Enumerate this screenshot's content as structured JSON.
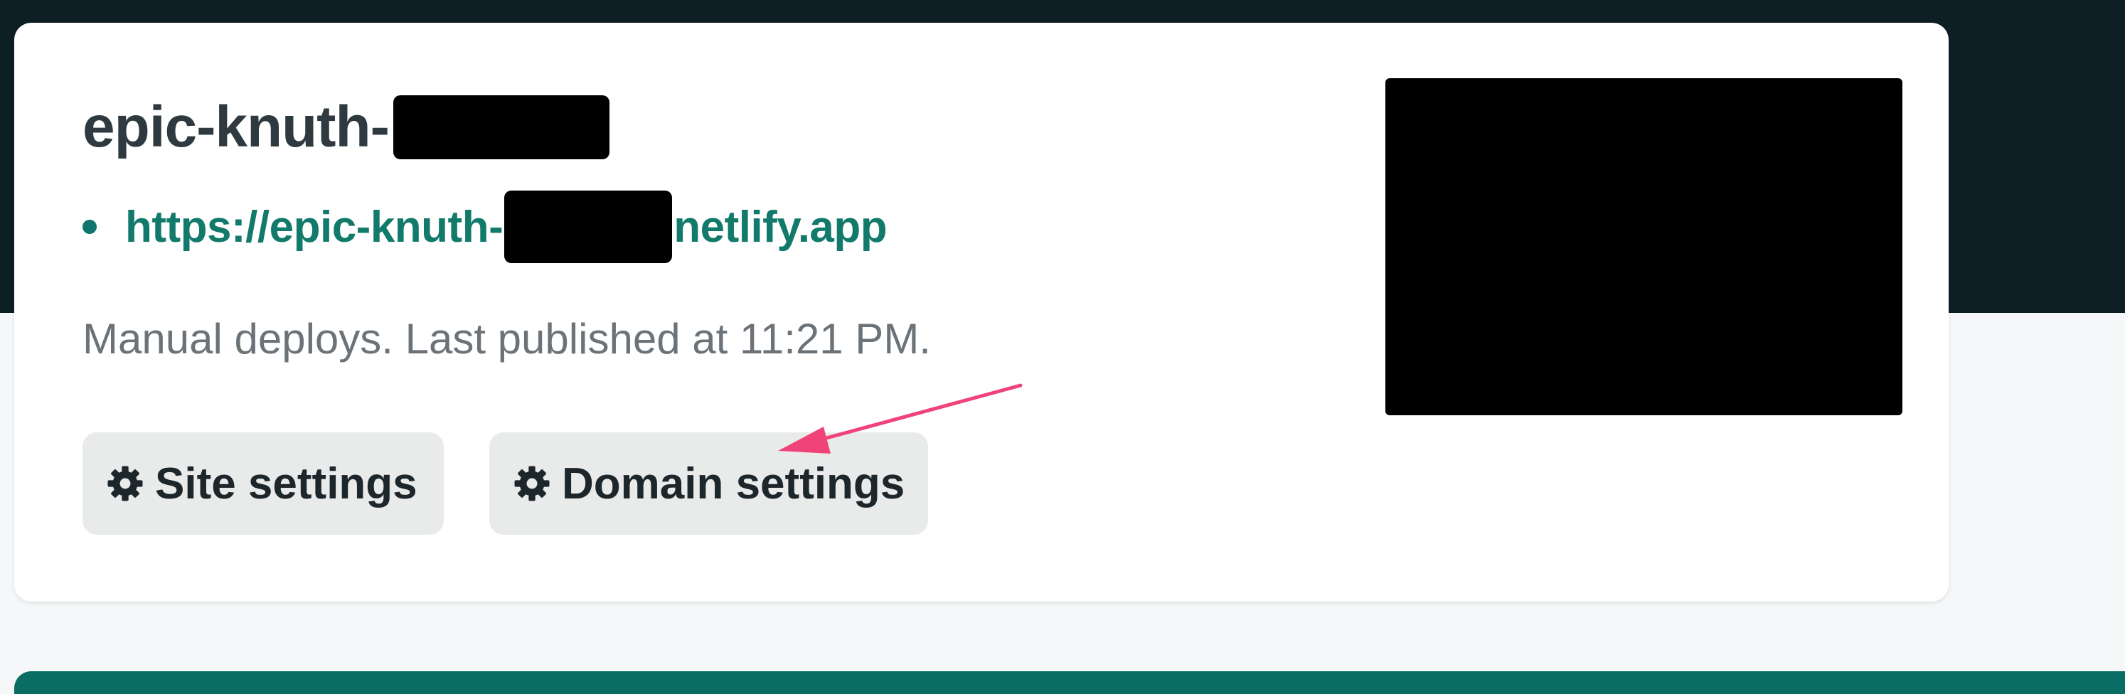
{
  "site": {
    "title_prefix": "epic-knuth-",
    "url_prefix": "https://epic-knuth-",
    "url_suffix": "netlify.app",
    "status": "Manual deploys. Last published at 11:21 PM."
  },
  "actions": {
    "site_settings_label": "Site settings",
    "domain_settings_label": "Domain settings"
  },
  "icons": {
    "settings": "gear-icon",
    "bullet": "status-dot",
    "annotation": "arrow-icon"
  },
  "colors": {
    "header_bg": "#0e1e25",
    "page_bg": "#f5f7f8",
    "card_bg": "#ffffff",
    "link": "#127a6a",
    "button_bg": "#e9ebeb",
    "annotation": "#f0437a",
    "footer_band": "#0a6d63"
  }
}
